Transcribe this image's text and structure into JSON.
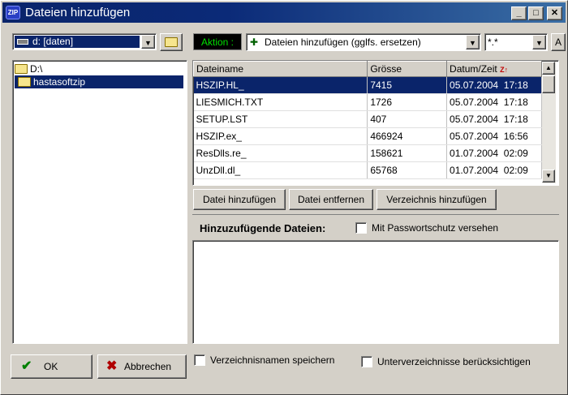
{
  "window": {
    "title": "Dateien hinzufügen",
    "icon_label": "ZIP"
  },
  "drive_combo": {
    "value": "d: [daten]"
  },
  "action": {
    "label": "Aktion :",
    "value": "Dateien hinzufügen (gglfs. ersetzen)"
  },
  "filter_combo": {
    "value": "*.*"
  },
  "tree": {
    "items": [
      {
        "label": "D:\\"
      },
      {
        "label": "hastasoftzip"
      }
    ]
  },
  "file_table": {
    "columns": [
      "Dateiname",
      "Grösse",
      "Datum/Zeit"
    ],
    "sort_icon": "Z A ↑",
    "rows": [
      {
        "name": "HSZIP.HL_",
        "size": "7415",
        "date": "05.07.2004",
        "time": "17:18"
      },
      {
        "name": "LIESMICH.TXT",
        "size": "1726",
        "date": "05.07.2004",
        "time": "17:18"
      },
      {
        "name": "SETUP.LST",
        "size": "407",
        "date": "05.07.2004",
        "time": "17:18"
      },
      {
        "name": "HSZIP.ex_",
        "size": "466924",
        "date": "05.07.2004",
        "time": "16:56"
      },
      {
        "name": "ResDlls.re_",
        "size": "158621",
        "date": "01.07.2004",
        "time": "02:09"
      },
      {
        "name": "UnzDll.dl_",
        "size": "65768",
        "date": "01.07.2004",
        "time": "02:09"
      }
    ]
  },
  "buttons": {
    "add_file": "Datei hinzufügen",
    "remove_file": "Datei entfernen",
    "add_folder": "Verzeichnis hinzufügen",
    "ok": "OK",
    "cancel": "Abbrechen"
  },
  "add_files_label": "Hinzuzufügende Dateien:",
  "checkboxes": {
    "password": "Mit Passwortschutz versehen",
    "save_folder_names": "Verzeichnisnamen speichern",
    "include_subfolders": "Unterverzeichnisse berücksichtigen"
  },
  "colors": {
    "titlebar": "#0a246a",
    "selection": "#0a246a",
    "action_label_bg": "#000000",
    "action_label_fg": "#00ff00"
  }
}
